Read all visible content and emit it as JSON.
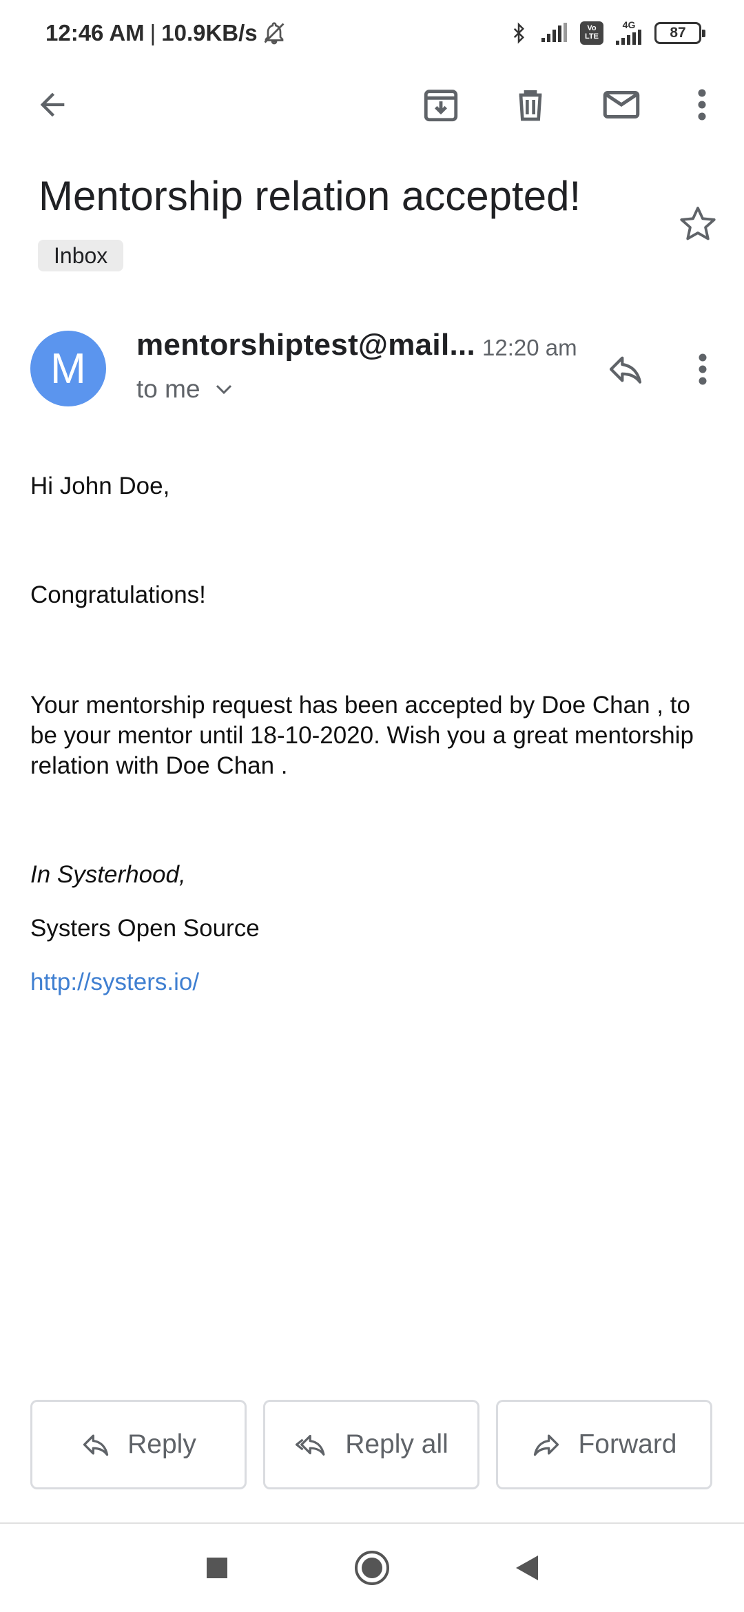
{
  "status_bar": {
    "time": "12:46 AM",
    "separator": "|",
    "speed": "10.9KB/s",
    "battery": "87",
    "volte_label": "Vo LTE",
    "network_label": "4G"
  },
  "email": {
    "subject": "Mentorship relation accepted!",
    "label": "Inbox",
    "avatar_letter": "M",
    "sender": "mentorshiptest@mail....",
    "time": "12:20 am",
    "recipient": "to me",
    "greeting": "Hi John Doe,",
    "congrats": "Congratulations!",
    "body_main": "Your mentorship request has been accepted by Doe Chan , to be your mentor until 18-10-2020. Wish you a great mentorship relation with Doe Chan .",
    "sign_off": "In Systerhood,",
    "org": "Systers Open Source",
    "link": "http://systers.io/"
  },
  "actions": {
    "reply": "Reply",
    "reply_all": "Reply all",
    "forward": "Forward"
  },
  "colors": {
    "avatar": "#5b95ee",
    "link": "#3f7fd1",
    "icon": "#5f6368"
  }
}
